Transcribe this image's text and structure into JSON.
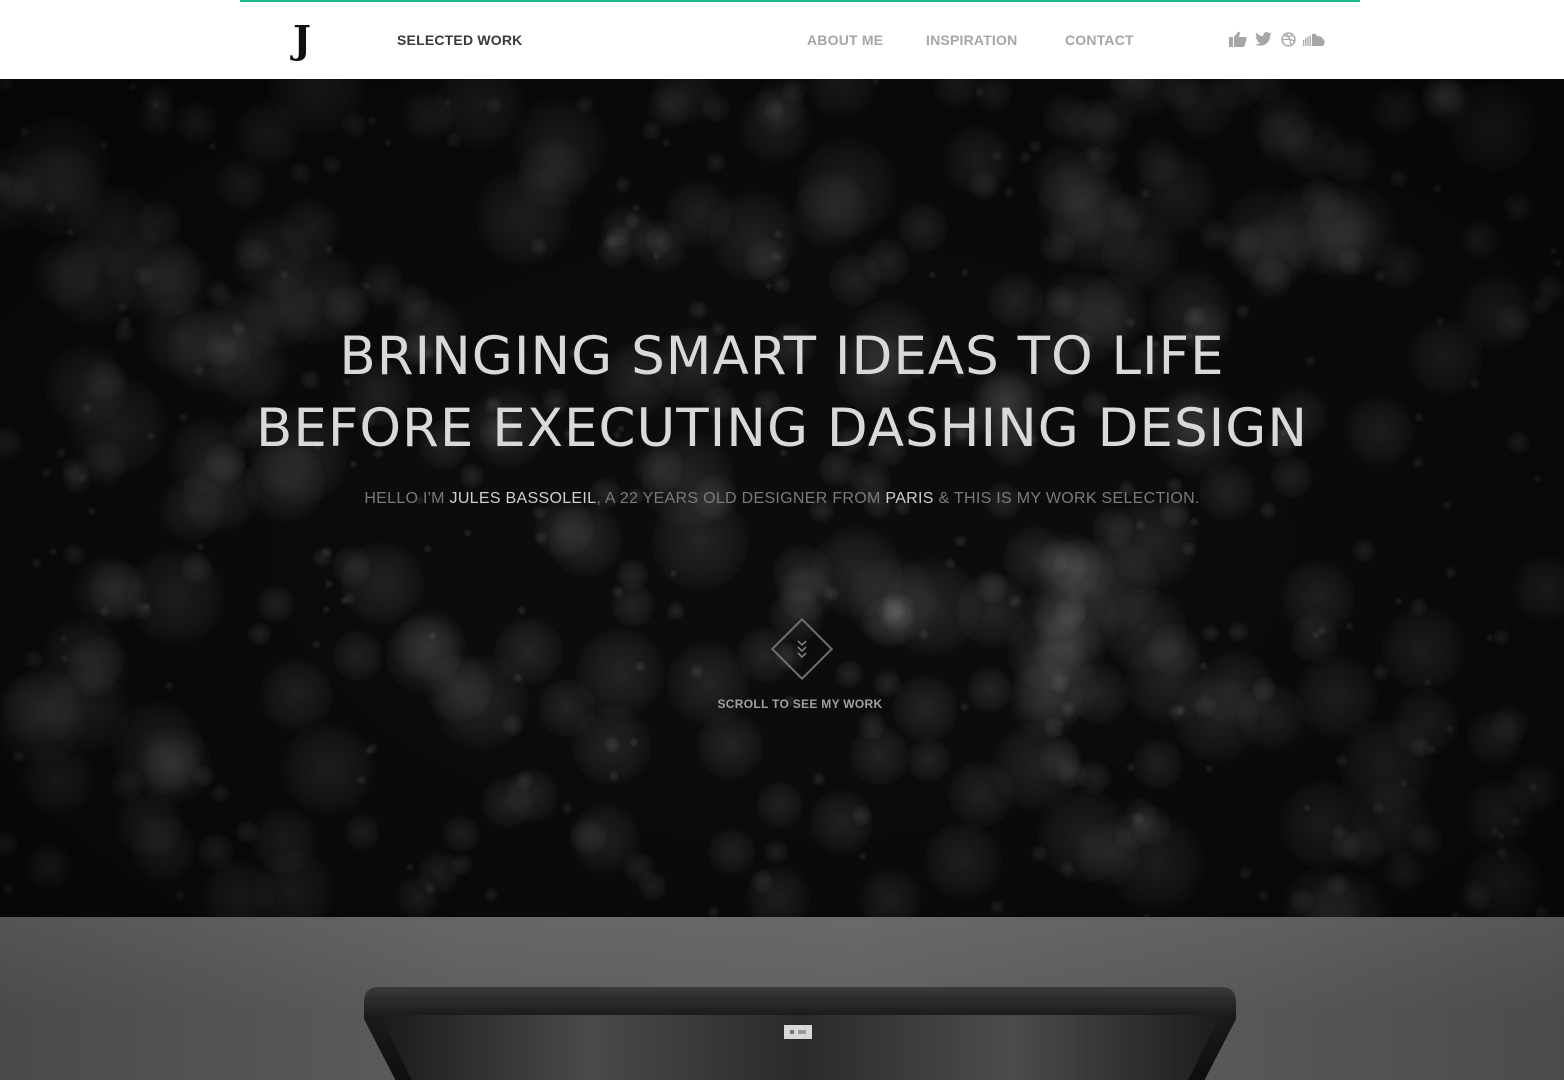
{
  "header": {
    "logo": "J",
    "nav": {
      "selected_work": "SELECTED WORK",
      "about_me": "ABOUT ME",
      "inspiration": "INSPIRATION",
      "contact": "CONTACT"
    },
    "social_icons": [
      "like-icon",
      "twitter-icon",
      "dribbble-icon",
      "soundcloud-icon"
    ]
  },
  "hero": {
    "headline_line1": "BRINGING SMART IDEAS TO LIFE",
    "headline_line2": "BEFORE EXECUTING DASHING DESIGN",
    "intro": {
      "prefix": "HELLO I'M ",
      "name": "JULES BASSOLEIL",
      "middle": ", A 22 YEARS OLD DESIGNER FROM ",
      "city": "PARIS",
      "suffix": " & THIS IS MY WORK SELECTION."
    },
    "scroll_label": "SCROLL TO SEE MY WORK",
    "scroll_icon": "chevrons-down-icon"
  },
  "colors": {
    "accent": "#1fbc8f",
    "nav_active": "#3a3a3a",
    "nav_inactive": "#a6a6a6",
    "hero_bg": "#0c0c0c",
    "hero_text": "#d9d9d9",
    "hero_muted": "#7a7a7a"
  }
}
